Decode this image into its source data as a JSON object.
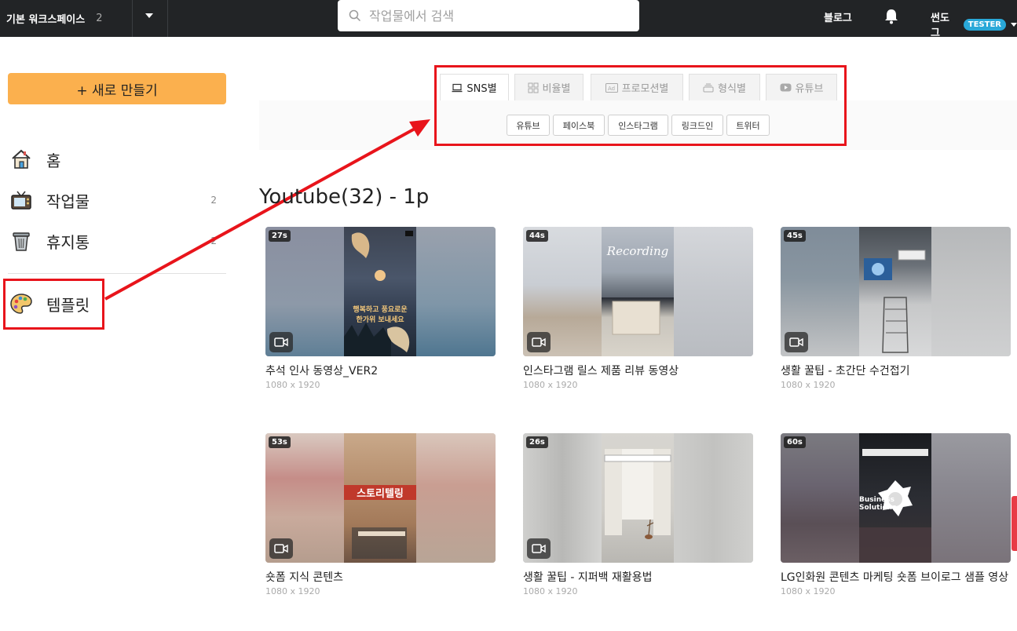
{
  "topbar": {
    "workspace_name": "기본 워크스페이스",
    "workspace_count": "2",
    "search_placeholder": "작업물에서 검색",
    "blog_label": "블로그",
    "username": "썬도그",
    "user_badge": "TESTER"
  },
  "sidebar": {
    "new_button": "+ 새로 만들기",
    "items": [
      {
        "label": "홈",
        "count": "",
        "icon": "house-icon"
      },
      {
        "label": "작업물",
        "count": "2",
        "icon": "tv-icon"
      },
      {
        "label": "휴지통",
        "count": "2",
        "icon": "trash-icon"
      },
      {
        "label": "템플릿",
        "count": "",
        "icon": "palette-icon"
      }
    ]
  },
  "template_tabs": [
    {
      "label": "SNS별",
      "active": true,
      "icon": "laptop-icon"
    },
    {
      "label": "비율별",
      "active": false,
      "icon": "grid-icon"
    },
    {
      "label": "프로모션별",
      "active": false,
      "icon": "ad-icon"
    },
    {
      "label": "형식별",
      "active": false,
      "icon": "stack-icon"
    },
    {
      "label": "유튜브",
      "active": false,
      "icon": "youtube-icon"
    }
  ],
  "sns_chips": [
    "유튜브",
    "페이스북",
    "인스타그램",
    "링크드인",
    "트위터"
  ],
  "section_title": "Youtube(32) - 1p",
  "cards": [
    {
      "duration": "27s",
      "title": "추석 인사 동영상_VER2",
      "size": "1080 x 1920"
    },
    {
      "duration": "44s",
      "title": "인스타그램 릴스 제품 리뷰 동영상",
      "size": "1080 x 1920"
    },
    {
      "duration": "45s",
      "title": "생활 꿀팁 - 초간단 수건접기",
      "size": "1080 x 1920"
    },
    {
      "duration": "53s",
      "title": "숏폼 지식 콘텐츠",
      "size": "1080 x 1920"
    },
    {
      "duration": "26s",
      "title": "생활 꿀팁 - 지퍼백 재활용법",
      "size": "1080 x 1920"
    },
    {
      "duration": "60s",
      "title": "LG인화원 콘텐츠 마케팅 숏폼 브이로그 샘플 영상",
      "size": "1080 x 1920"
    }
  ],
  "thumb_texts": {
    "card1_line1": "행복하고 풍요로운",
    "card1_line2": "한가위 보내세요",
    "card2_overlay": "Recording",
    "card4_overlay": "스토리텔링",
    "card6_overlay": "Business Solutions"
  },
  "colors": {
    "topbar_bg": "#222426",
    "new_button": "#fbb04e",
    "badge": "#29a8d8",
    "highlight_red": "#e8141b"
  }
}
